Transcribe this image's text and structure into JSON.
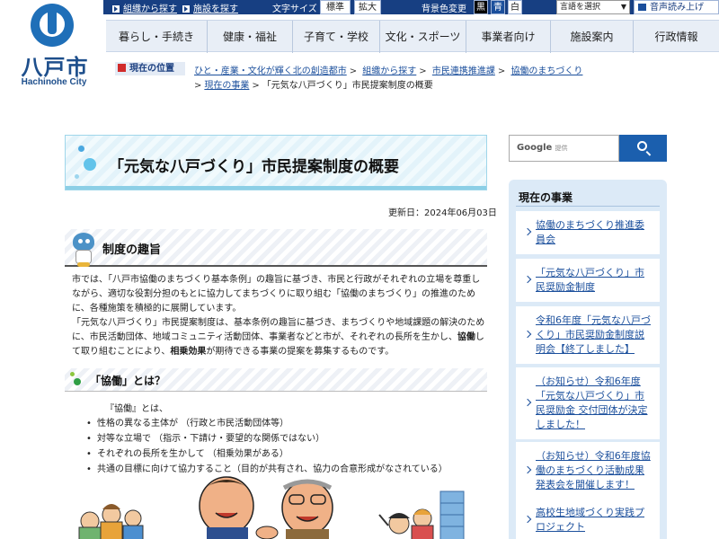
{
  "logo": {
    "name_jp": "八戸市",
    "name_en": "Hachinohe City"
  },
  "topbar": {
    "link_org": "組織から探す",
    "link_facility": "施設を探す",
    "font_size_label": "文字サイズ",
    "font_standard": "標準",
    "font_large": "拡大",
    "bgcolor_label": "背景色変更",
    "bg_black": "黒",
    "bg_blue": "青",
    "bg_white": "白",
    "language_select": "言語を選択",
    "speech": "音声読み上げ"
  },
  "nav": {
    "items": [
      {
        "label": "暮らし・手続き"
      },
      {
        "label": "健康・福祉"
      },
      {
        "label": "子育て・学校"
      },
      {
        "label": "文化・スポーツ"
      },
      {
        "label": "事業者向け"
      },
      {
        "label": "施設案内"
      },
      {
        "label": "行政情報"
      }
    ]
  },
  "breadcrumb": {
    "badge": "現在の位置",
    "items": [
      "ひと・産業・文化が輝く北の創造都市",
      "組織から探す",
      "市民連携推進課",
      "協働のまちづくり",
      "現在の事業"
    ],
    "current": "「元気な八戸づくり」市民提案制度の概要"
  },
  "main": {
    "title": "「元気な八戸づくり」市民提案制度の概要",
    "updated": "更新日：2024年06月03日",
    "section1_heading": "制度の趣旨",
    "para1_before": "市では、「八戸市協働のまちづくり基本条例」の趣旨に基づき、市民と行政がそれぞれの立場を尊重しながら、適切な役割分担のもとに協力してまちづくりに取り組む「協働のまちづくり」の推進のために、各種施策を積極的に展開しています。",
    "para2_before": "「元気な八戸づくり」市民提案制度は、基本条例の趣旨に基づき、まちづくりや地域課題の解決のために、市民活動団体、地域コミュニティ活動団体、事業者などと市が、それぞれの長所を生かし、",
    "para2_bold1": "協働",
    "para2_mid": "して取り組むことにより、",
    "para2_bold2": "相乗効果",
    "para2_after": "が期待できる事業の提案を募集するものです。",
    "section2_heading": "「協働」とは？",
    "intro2": "『協働』とは、",
    "bullets": [
      "性格の異なる主体が （行政と市民活動団体等）",
      "対等な立場で （指示・下請け・要望的な関係ではない）",
      "それぞれの長所を生かして （相乗効果がある）",
      "共通の目標に向けて協力すること（目的が共有され、協力の合意形成がなされている）"
    ]
  },
  "search": {
    "google": "Google",
    "teikyo": "提供"
  },
  "sidebar": {
    "heading": "現在の事業",
    "items": [
      {
        "label": "協働のまちづくり推進委員会"
      },
      {
        "label": "「元気な八戸づくり」市民奨励金制度"
      },
      {
        "label": "令和6年度「元気な八戸づくり」市民奨励金制度説明会【終了しました】"
      },
      {
        "label": "（お知らせ）令和6年度「元気な八戸づくり」市民奨励金 交付団体が決定しました！"
      },
      {
        "label": "（お知らせ）令和6年度協働のまちづくり活動成果発表会を開催します！"
      },
      {
        "label": "高校生地域づくり実践プロジェクト"
      }
    ]
  },
  "colors": {
    "header_navy": "#173f82",
    "link_blue": "#1b4f9c",
    "sidebar_bg": "#dceaf7",
    "search_button": "#1b5fae"
  }
}
